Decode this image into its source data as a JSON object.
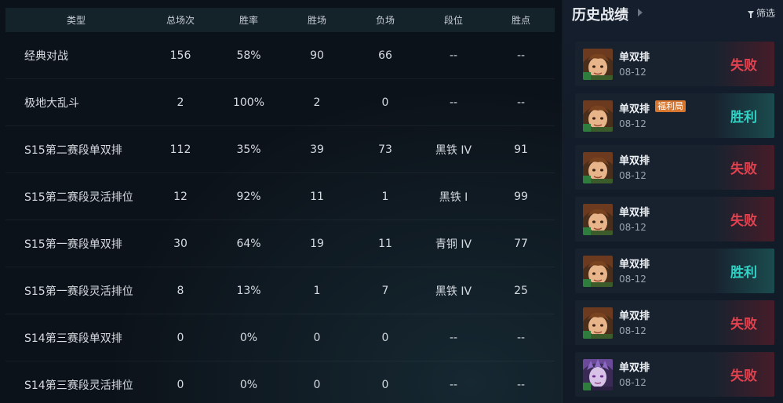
{
  "stats": {
    "headers": [
      "类型",
      "总场次",
      "胜率",
      "胜场",
      "负场",
      "段位",
      "胜点"
    ],
    "rows": [
      [
        "经典对战",
        "156",
        "58%",
        "90",
        "66",
        "--",
        "--"
      ],
      [
        "极地大乱斗",
        "2",
        "100%",
        "2",
        "0",
        "--",
        "--"
      ],
      [
        "S15第二赛段单双排",
        "112",
        "35%",
        "39",
        "73",
        "黑铁 IV",
        "91"
      ],
      [
        "S15第二赛段灵活排位",
        "12",
        "92%",
        "11",
        "1",
        "黑铁 Ⅰ",
        "99"
      ],
      [
        "S15第一赛段单双排",
        "30",
        "64%",
        "19",
        "11",
        "青铜 IV",
        "77"
      ],
      [
        "S15第一赛段灵活排位",
        "8",
        "13%",
        "1",
        "7",
        "黑铁 IV",
        "25"
      ],
      [
        "S14第三赛段单双排",
        "0",
        "0%",
        "0",
        "0",
        "--",
        "--"
      ],
      [
        "S14第三赛段灵活排位",
        "0",
        "0%",
        "0",
        "0",
        "--",
        "--"
      ]
    ]
  },
  "history": {
    "title": "历史战绩",
    "filter_label": "筛选",
    "filter_icon": "funnel-icon",
    "colors": {
      "loss": "#e0424f",
      "win": "#33d2c4",
      "badge": "#d6762e"
    },
    "matches": [
      {
        "mode": "单双排",
        "badge": "",
        "date": "08-12",
        "result": "失败",
        "outcome": "loss",
        "champion": "girl"
      },
      {
        "mode": "单双排",
        "badge": "福利局",
        "date": "08-12",
        "result": "胜利",
        "outcome": "win",
        "champion": "girl"
      },
      {
        "mode": "单双排",
        "badge": "",
        "date": "08-12",
        "result": "失败",
        "outcome": "loss",
        "champion": "girl"
      },
      {
        "mode": "单双排",
        "badge": "",
        "date": "08-12",
        "result": "失败",
        "outcome": "loss",
        "champion": "girl"
      },
      {
        "mode": "单双排",
        "badge": "",
        "date": "08-12",
        "result": "胜利",
        "outcome": "win",
        "champion": "girl"
      },
      {
        "mode": "单双排",
        "badge": "",
        "date": "08-12",
        "result": "失败",
        "outcome": "loss",
        "champion": "girl"
      },
      {
        "mode": "单双排",
        "badge": "",
        "date": "08-12",
        "result": "失败",
        "outcome": "loss",
        "champion": "purple"
      }
    ]
  }
}
